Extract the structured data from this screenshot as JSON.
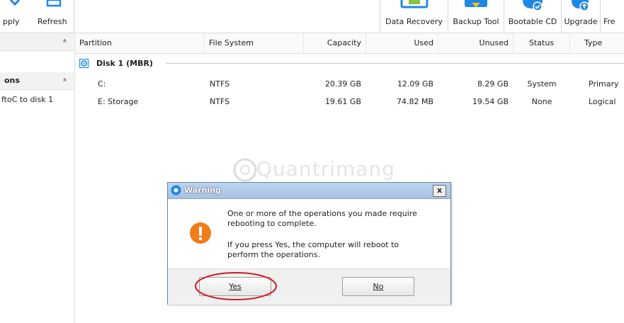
{
  "toolbar": {
    "apply_label": "pply",
    "refresh_label": "Refresh",
    "buttons": [
      {
        "label": "Data Recovery"
      },
      {
        "label": "Backup Tool"
      },
      {
        "label": "Bootable CD"
      },
      {
        "label": "Upgrade"
      },
      {
        "label": "Fre"
      }
    ],
    "accent": "#1e88e5"
  },
  "left_panel": {
    "section1_chevron": "«",
    "section2_label": "ons",
    "section2_chevron": "«",
    "item": "ftoC to disk 1"
  },
  "table": {
    "columns": [
      "Partition",
      "File System",
      "Capacity",
      "Used",
      "Unused",
      "Status",
      "Type"
    ],
    "disk_label": "Disk 1 (MBR)",
    "rows": [
      {
        "partition": "C:",
        "fs": "NTFS",
        "capacity": "20.39 GB",
        "used": "12.09 GB",
        "unused": "8.29 GB",
        "status": "System",
        "type": "Primary"
      },
      {
        "partition": "E: Storage",
        "fs": "NTFS",
        "capacity": "19.61 GB",
        "used": "74.82 MB",
        "unused": "19.54 GB",
        "status": "None",
        "type": "Logical"
      }
    ]
  },
  "watermark": "Quantrimang",
  "dialog": {
    "title": "Warning",
    "close": "x",
    "message1": "One or more of the operations you made require rebooting to complete.",
    "message2": "If you press Yes, the computer will reboot to perform the operations.",
    "yes_label": "Yes",
    "no_label": "No",
    "highlight_color": "#d01c24"
  }
}
